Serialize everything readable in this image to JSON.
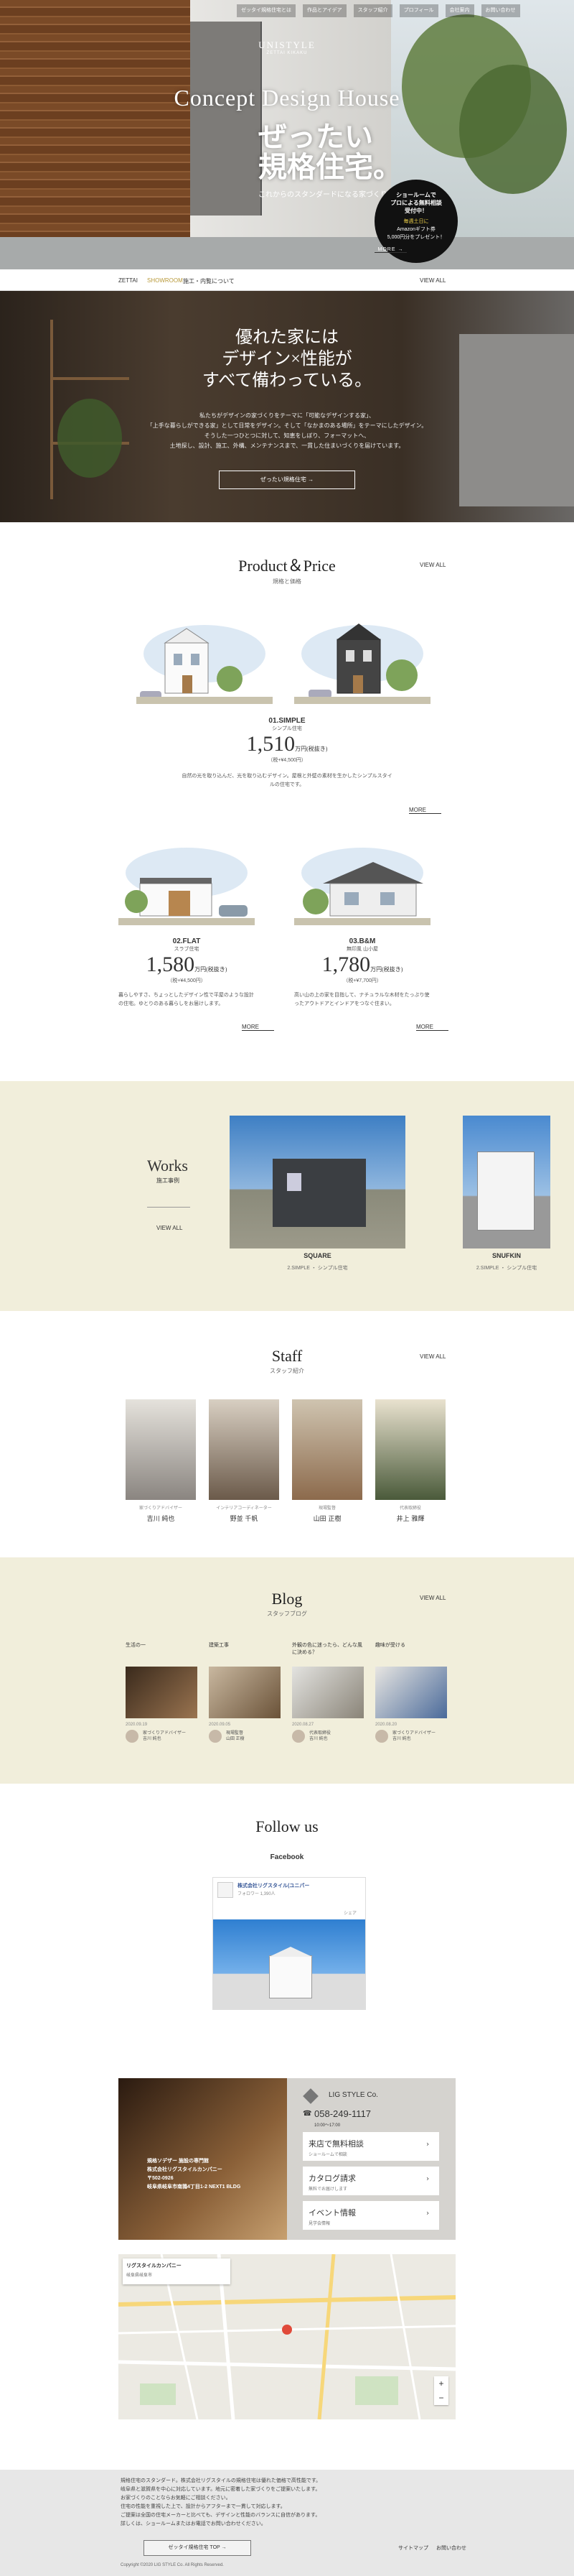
{
  "hero": {
    "nav": [
      "ゼッタイ規格住宅とは",
      "作品とアイデア",
      "スタッフ紹介",
      "プロフィール",
      "会社案内",
      "お問い合わせ"
    ],
    "logo_mark": "UNISTYLE",
    "logo_sub": "ZETTAI KIKAKU",
    "title_en": "Concept Design House",
    "title_jp_1": "ぜったい",
    "title_jp_2": "規格住宅。",
    "subtitle": "これからのスタンダードになる家づくり",
    "badge": {
      "line1": "ショールームで",
      "line2": "プロによる無料相談",
      "line3": "受付中！",
      "line4": "毎週土日に",
      "line5": "Amazonギフト券",
      "line6": "5,000円分をプレゼント！",
      "more": "MORE →"
    }
  },
  "crumb": {
    "home": "ZETTAI",
    "here": "SHOWROOM",
    "menu": "施工・内覧について",
    "view": "VIEW ALL"
  },
  "concept": {
    "title_1": "優れた家には",
    "title_2": "デザイン×性能が",
    "title_3": "すべて備わっている。",
    "body": [
      "私たちがデザインの家づくりをテーマに「可能なデザインする家」、",
      "「上手な暮らしができる家」として日常をデザイン。そして「なかまのある場所」をテーマにしたデザイン。",
      "そうした一つひとつに対して、知恵をしぼり、フォーマットへ、",
      "土地探し、設計、施工、外構、メンテナンスまで、一貫した住まいづくりを届けています。"
    ],
    "button": "ぜったい規格住宅 →"
  },
  "product": {
    "title": "Product＆Price",
    "subtitle": "規格と価格",
    "view_all": "VIEW ALL",
    "items": [
      {
        "name": "01.SIMPLE",
        "sub": "シンプル住宅",
        "price": "1,510",
        "unit": "万円(税抜き)",
        "tax": "（税+¥4,500円）",
        "desc": "自然の光を取り込んだ、光を取り込むデザイン。屋根と外壁の素材を生かしたシンプルスタイルの住宅です。",
        "more": "MORE"
      },
      {
        "name": "02.FLAT",
        "sub": "スラブ住宅",
        "price": "1,580",
        "unit": "万円(税抜き)",
        "tax": "（税+¥4,500円）",
        "desc": "暮らしやすさ、ちょっとしたデザイン性で平屋のような設計の住宅。ゆとりのある暮らしをお届けします。",
        "more": "MORE"
      },
      {
        "name": "03.B&M",
        "sub": "無印風 山小屋",
        "price": "1,780",
        "unit": "万円(税抜き)",
        "tax": "（税+¥7,700円）",
        "desc": "高い山の上の家を目指して、ナチュラルな木材をたっぷり使ったアウトドアとインドアをつなぐ住まい。",
        "more": "MORE"
      }
    ]
  },
  "works": {
    "title": "Works",
    "subtitle": "施工事例",
    "view_all": "VIEW ALL",
    "items": [
      {
        "label": "SQUARE",
        "desc": "2.SIMPLE ・ シンプル住宅"
      },
      {
        "label": "SNUFKIN",
        "desc": "2.SIMPLE ・ シンプル住宅"
      }
    ]
  },
  "staff": {
    "title": "Staff",
    "subtitle": "スタッフ紹介",
    "view_all": "VIEW ALL",
    "people": [
      {
        "role": "家づくりアドバイザー",
        "name": "吉川 純也"
      },
      {
        "role": "インテリアコーディネーター",
        "name": "野並 千帆"
      },
      {
        "role": "現場監督",
        "name": "山田 正樹"
      },
      {
        "role": "代表取締役",
        "name": "井上 雅輝"
      }
    ]
  },
  "blog": {
    "title": "Blog",
    "subtitle": "スタッフブログ",
    "view_all": "VIEW ALL",
    "posts": [
      {
        "title": "生活の一",
        "date": "2020.09.19",
        "author": "家づくりアドバイザー",
        "name": "吉川 純也"
      },
      {
        "title": "建築工事",
        "date": "2020.09.05",
        "author": "現場監督",
        "name": "山田 正樹"
      },
      {
        "title": "外観の色に迷ったら、どんな風に決める？",
        "date": "2020.08.27",
        "author": "代表取締役",
        "name": "吉川 純也"
      },
      {
        "title": "趣味が受ける",
        "date": "2020.08.20",
        "author": "家づくりアドバイザー",
        "name": "吉川 純也"
      }
    ]
  },
  "follow": {
    "title": "Follow us",
    "facebook": "Facebook",
    "page_name": "株式会社リグスタイル(ユニパー",
    "page_sub": "フォロワー 1,390人",
    "share": "シェア"
  },
  "showroom": {
    "photo_text_1": "規格ソデザー 施設の専門館",
    "photo_text_2": "株式会社リグスタイルカンパニー",
    "photo_text_3": "〒502-0926",
    "photo_text_4": "岐阜県岐阜市南鶉4丁目1-2 NEXT1 BLDG",
    "company": "LIG STYLE Co.",
    "phone": "058-249-1117",
    "hours": "10:00～17:00",
    "links": [
      {
        "label": "来店で無料相談",
        "sub": "ショールームで相談"
      },
      {
        "label": "カタログ請求",
        "sub": "無料でお届けします"
      },
      {
        "label": "イベント情報",
        "sub": "見学会情報"
      }
    ]
  },
  "map": {
    "label": "リグスタイルカンパニー",
    "sub": "岐阜県岐阜市",
    "zoom_in": "+",
    "zoom_out": "−"
  },
  "footer": {
    "lines": [
      "規格住宅のスタンダード。株式会社リグスタイルの規格住宅は優れた価格で高性能です。",
      "岐阜県と滋賀県を中心に対応しています。地元に密着した家づくりをご提案いたします。",
      "お家づくりのことならお気軽にご相談ください。",
      "住宅の性能を重視した上で、設計からアフターまで一貫して対応します。",
      "ご提案は全国の住宅メーカーと比べても、デザインと性能のバランスに自信があります。",
      "詳しくは、ショールームまたはお電話でお問い合わせください。"
    ],
    "button": "ゼッタイ規格住宅 TOP →",
    "links": [
      "サイトマップ",
      "お問い合わせ"
    ],
    "copyright": "Copyright ©2020 LIG STYLE Co. All Rights Reserved."
  },
  "colors": {
    "accent": "#b8993a",
    "beige": "#f1eedb",
    "dark": "#111111"
  }
}
